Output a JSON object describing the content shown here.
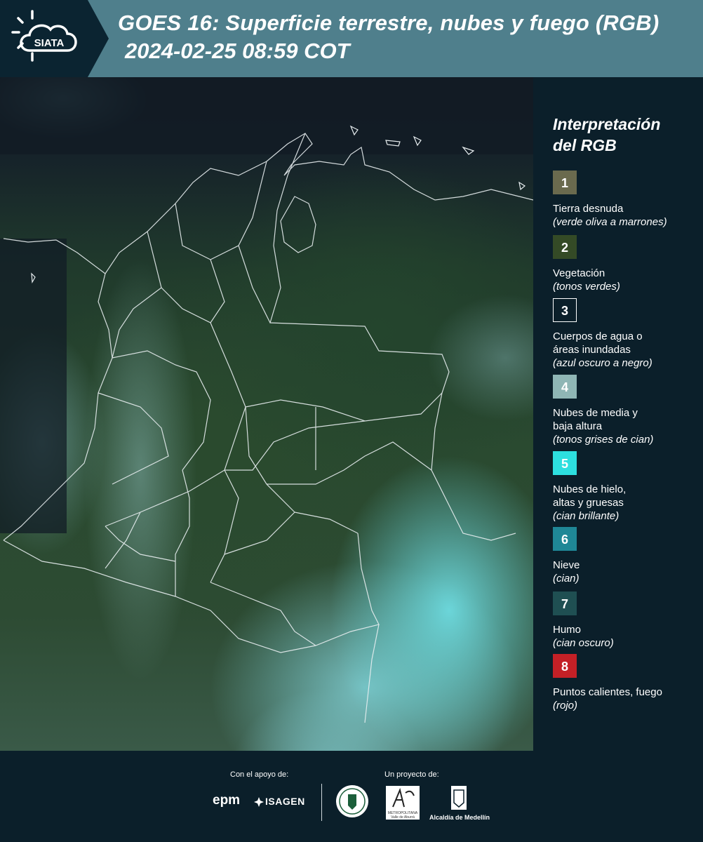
{
  "header": {
    "logo_text": "SIATA",
    "title": "GOES 16: Superficie terrestre, nubes y fuego (RGB)",
    "subtitle": "2024-02-25 08:59 COT"
  },
  "legend": {
    "title_line1": "Interpretación",
    "title_line2": "del RGB",
    "items": [
      {
        "number": "1",
        "label": "Tierra desnuda",
        "desc": "(verde oliva a marrones)",
        "color": "#6a6a4e",
        "border": "#6a6a4e"
      },
      {
        "number": "2",
        "label": "Vegetación",
        "desc": "(tonos verdes)",
        "color": "#344a26",
        "border": "#344a26"
      },
      {
        "number": "3",
        "label": "Cuerpos de agua o\náreas inundadas",
        "desc": "(azul oscuro a negro)",
        "color": "#0b1f2a",
        "border": "#ffffff"
      },
      {
        "number": "4",
        "label": "Nubes de media y\nbaja altura",
        "desc": "(tonos grises de cian)",
        "color": "#8fb6b5",
        "border": "#8fb6b5"
      },
      {
        "number": "5",
        "label": "Nubes de hielo,\naltas y gruesas",
        "desc": "(cian brillante)",
        "color": "#2ddfdf",
        "border": "#2ddfdf"
      },
      {
        "number": "6",
        "label": "Nieve",
        "desc": "(cian)",
        "color": "#1f8796",
        "border": "#1f8796"
      },
      {
        "number": "7",
        "label": "Humo",
        "desc": "(cian oscuro)",
        "color": "#1f4f52",
        "border": "#1f4f52"
      },
      {
        "number": "8",
        "label": "Puntos calientes, fuego",
        "desc": "(rojo)",
        "color": "#c42026",
        "border": "#c42026"
      }
    ]
  },
  "footer": {
    "support_label": "Con el apoyo de:",
    "project_label": "Un proyecto de:",
    "epm": "epm",
    "isagen": "ISAGEN",
    "amva_text": "METROPOLITANA\nValle de Aburrá",
    "medellin": "Alcaldía de Medellín"
  }
}
